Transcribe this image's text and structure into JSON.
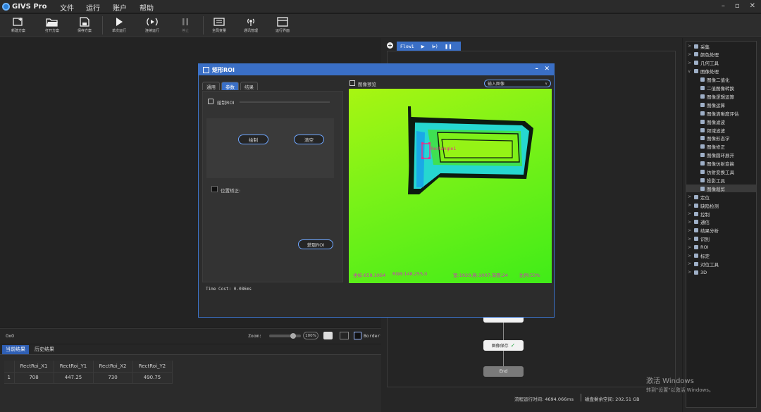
{
  "app": {
    "name": "GIVS Pro"
  },
  "menu": [
    "文件",
    "运行",
    "账户",
    "帮助"
  ],
  "window_controls": [
    "–",
    "▫",
    "✕"
  ],
  "toolbar": [
    {
      "label": "新建方案",
      "icon": "new-solution-icon"
    },
    {
      "label": "打开方案",
      "icon": "open-folder-icon"
    },
    {
      "label": "保存方案",
      "icon": "save-icon"
    },
    {
      "label": "单次运行",
      "icon": "play-icon"
    },
    {
      "label": "连续运行",
      "icon": "continuous-run-icon"
    },
    {
      "label": "停止",
      "icon": "pause-icon"
    },
    {
      "label": "全局变量",
      "icon": "global-variable-icon"
    },
    {
      "label": "通讯管理",
      "icon": "communication-icon"
    },
    {
      "label": "运行界面",
      "icon": "run-interface-icon"
    }
  ],
  "canvas": {
    "coords": "0x0",
    "zoom_label": "Zoom:",
    "zoom_value": "100%",
    "border_label": "Border"
  },
  "results": {
    "tabs": [
      "当前结果",
      "历史结果"
    ],
    "columns": [
      "RectRoi_X1",
      "RectRoi_Y1",
      "RectRoi_X2",
      "RectRoi_Y2"
    ],
    "rows": [
      {
        "index": "1",
        "values": [
          "708",
          "447.25",
          "730",
          "490.75"
        ]
      }
    ]
  },
  "flow": {
    "tab_label": "Flow1",
    "nodes": [
      "图像保存",
      "End"
    ]
  },
  "tree": [
    {
      "label": "采集",
      "level": 0,
      "arrow": ">"
    },
    {
      "label": "颜色处理",
      "level": 0,
      "arrow": ">"
    },
    {
      "label": "几何工具",
      "level": 0,
      "arrow": ">"
    },
    {
      "label": "图像处理",
      "level": 0,
      "arrow": "∨"
    },
    {
      "label": "图像二值化",
      "level": 1
    },
    {
      "label": "二值图像转换",
      "level": 1
    },
    {
      "label": "图像逻辑运算",
      "level": 1
    },
    {
      "label": "图像运算",
      "level": 1
    },
    {
      "label": "图像清晰度评估",
      "level": 1
    },
    {
      "label": "图像滤波",
      "level": 1
    },
    {
      "label": "频域滤波",
      "level": 1
    },
    {
      "label": "图像形态学",
      "level": 1
    },
    {
      "label": "图像修正",
      "level": 1
    },
    {
      "label": "图像圆环展开",
      "level": 1
    },
    {
      "label": "图像仿射变换",
      "level": 1
    },
    {
      "label": "仿射变换工具",
      "level": 1
    },
    {
      "label": "投影工具",
      "level": 1
    },
    {
      "label": "图像裁剪",
      "level": 1,
      "selected": true
    },
    {
      "label": "定位",
      "level": 0,
      "arrow": ">"
    },
    {
      "label": "缺陷检测",
      "level": 0,
      "arrow": ">"
    },
    {
      "label": "控制",
      "level": 0,
      "arrow": ">"
    },
    {
      "label": "通信",
      "level": 0,
      "arrow": ">"
    },
    {
      "label": "结果分析",
      "level": 0,
      "arrow": ">"
    },
    {
      "label": "识别",
      "level": 0,
      "arrow": ">"
    },
    {
      "label": "ROI",
      "level": 0,
      "arrow": ">"
    },
    {
      "label": "标定",
      "level": 0,
      "arrow": ">"
    },
    {
      "label": "对位工具",
      "level": 0,
      "arrow": ">"
    },
    {
      "label": "3D",
      "level": 0,
      "arrow": ">"
    }
  ],
  "dialog": {
    "title": "矩形ROI",
    "tabs": [
      "通用",
      "参数",
      "结果"
    ],
    "draw_roi_label": "绘制ROI",
    "draw_button": "绘制",
    "clear_button": "清空",
    "position_correction": "位置矫正:",
    "get_roi_button": "获取ROI",
    "time_cost": "Time Cost: 0.086ms",
    "preview_title": "图像预览",
    "input_image": "输入图像",
    "roi_label": "Rectangle1",
    "status_coord": "坐标:659,1064",
    "status_rgb": "RGB:148,255,0",
    "status_size": "宽:1920,高:1007,深度:24",
    "status_ratio": "比例:53%"
  },
  "statusbar": {
    "runtime": "流程运行时间: 4694.066ms",
    "disk": "磁盘剩余空间: 202.51 GB"
  },
  "watermark": {
    "line1": "激活 Windows",
    "line2": "转到\"设置\"以激活 Windows。"
  },
  "colors": {
    "accent": "#3a6fc6",
    "roi": "#e8308a",
    "status_text": "#d42fc0",
    "preview_green": "#7cf218"
  }
}
